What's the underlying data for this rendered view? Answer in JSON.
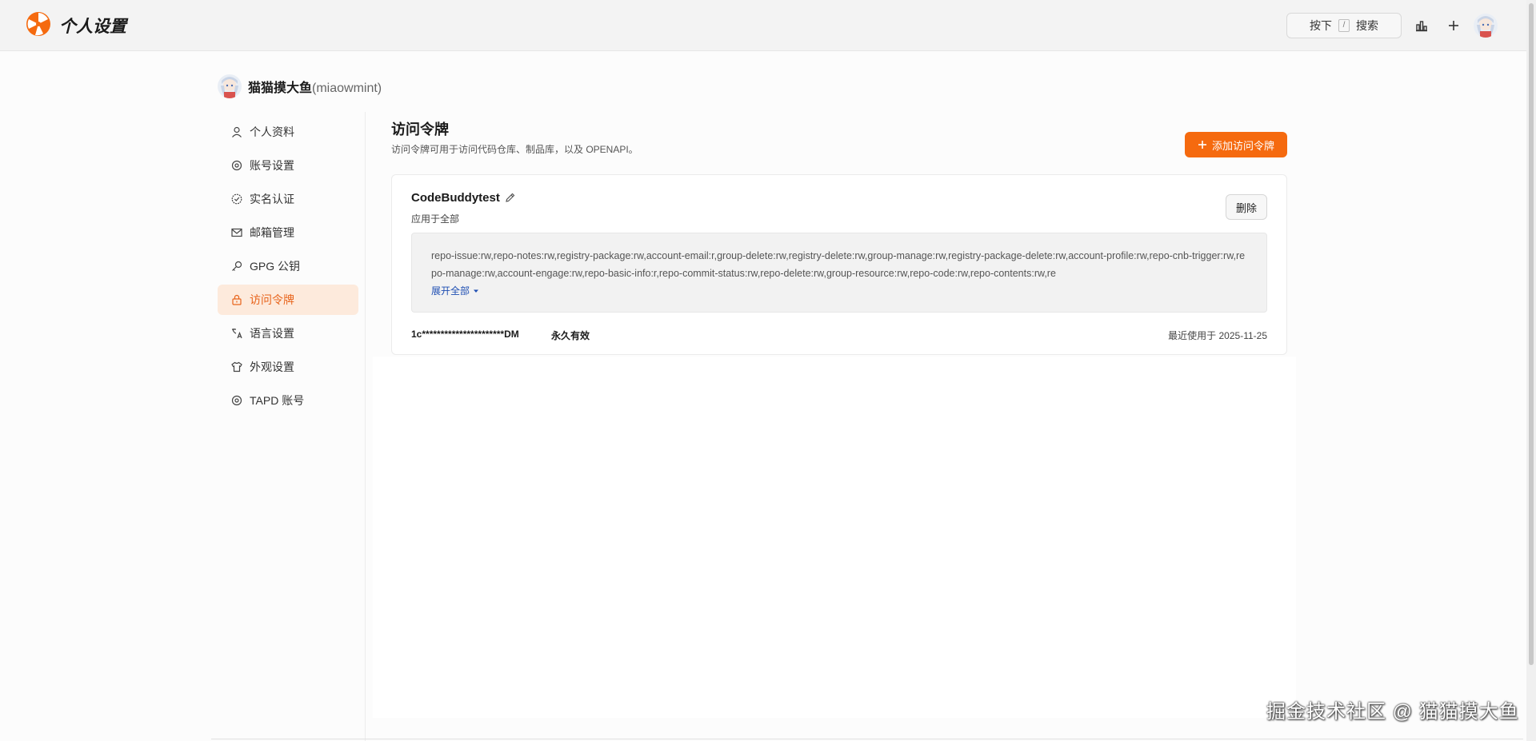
{
  "app": {
    "title": "个人设置",
    "brand_color": "#f56a0f"
  },
  "topbar": {
    "search_prefix": "按下",
    "search_key": "/",
    "search_label": "搜索",
    "icons": [
      "chart-bar-icon",
      "plus-icon",
      "avatar"
    ]
  },
  "user": {
    "name": "猫猫摸大鱼",
    "login": "(miaowmint)"
  },
  "sidebar": {
    "items": [
      {
        "label": "个人资料",
        "icon": "user-icon"
      },
      {
        "label": "账号设置",
        "icon": "gear-icon"
      },
      {
        "label": "实名认证",
        "icon": "verified-icon"
      },
      {
        "label": "邮箱管理",
        "icon": "mail-icon"
      },
      {
        "label": "GPG 公钥",
        "icon": "key-icon"
      },
      {
        "label": "访问令牌",
        "icon": "lock-icon",
        "active": true
      },
      {
        "label": "语言设置",
        "icon": "translate-icon"
      },
      {
        "label": "外观设置",
        "icon": "shirt-icon"
      },
      {
        "label": "TAPD 账号",
        "icon": "gear-icon"
      }
    ]
  },
  "main": {
    "title": "访问令牌",
    "description": "访问令牌可用于访问代码仓库、制品库，以及 OPENAPI。",
    "add_button": "添加访问令牌"
  },
  "token": {
    "name": "CodeBuddytest",
    "scope": "应用于全部",
    "delete_label": "删除",
    "permissions": "repo-issue:rw,repo-notes:rw,registry-package:rw,account-email:r,group-delete:rw,registry-delete:rw,group-manage:rw,registry-package-delete:rw,account-profile:rw,repo-cnb-trigger:rw,repo-manage:rw,account-engage:rw,repo-basic-info:r,repo-commit-status:rw,repo-delete:rw,group-resource:rw,repo-code:rw,repo-contents:rw,re",
    "expand_label": "展开全部",
    "value": "1c**********************DM",
    "validity": "永久有效",
    "last_used": "最近使用于 2025-11-25"
  },
  "watermark": "掘金技术社区 @ 猫猫摸大鱼"
}
